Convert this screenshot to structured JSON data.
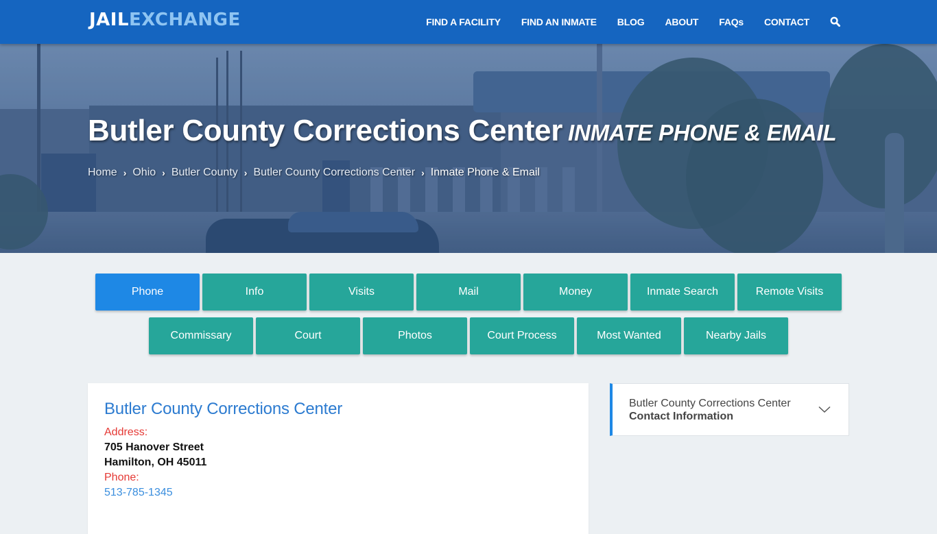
{
  "header": {
    "logo": {
      "part1": "JAIL",
      "part2": "EXCHANGE"
    },
    "nav": [
      {
        "label": "FIND A FACILITY"
      },
      {
        "label": "FIND AN INMATE"
      },
      {
        "label": "BLOG"
      },
      {
        "label": "ABOUT"
      },
      {
        "label": "FAQs"
      },
      {
        "label": "CONTACT"
      }
    ],
    "search_icon": "search-icon"
  },
  "hero": {
    "title": "Butler County Corrections Center",
    "subtitle": "INMATE PHONE & EMAIL",
    "breadcrumb": [
      {
        "label": "Home"
      },
      {
        "label": "Ohio"
      },
      {
        "label": "Butler County"
      },
      {
        "label": "Butler County Corrections Center"
      },
      {
        "label": "Inmate Phone & Email"
      }
    ]
  },
  "tabs": {
    "row1": [
      {
        "label": "Phone",
        "active": true
      },
      {
        "label": "Info"
      },
      {
        "label": "Visits"
      },
      {
        "label": "Mail"
      },
      {
        "label": "Money"
      },
      {
        "label": "Inmate Search"
      },
      {
        "label": "Remote Visits"
      }
    ],
    "row2": [
      {
        "label": "Commissary"
      },
      {
        "label": "Court"
      },
      {
        "label": "Photos"
      },
      {
        "label": "Court Process"
      },
      {
        "label": "Most Wanted"
      },
      {
        "label": "Nearby Jails"
      }
    ]
  },
  "facility": {
    "name": "Butler County Corrections Center",
    "address_label": "Address:",
    "address_line1": "705 Hanover Street",
    "address_line2": "Hamilton, OH 45011",
    "phone_label": "Phone:",
    "phone": "513-785-1345"
  },
  "sidebar": {
    "title": "Butler County Corrections Center",
    "subtitle": "Contact Information",
    "expand_icon": "chevron-down-icon"
  },
  "colors": {
    "header_bg": "#1565c0",
    "logo_accent": "#8ec4f2",
    "tab_bg": "#26a69a",
    "tab_active": "#1e88e5",
    "heading_blue": "#2c7bd0",
    "label_red": "#e53935",
    "link_blue": "#3a8ede"
  }
}
